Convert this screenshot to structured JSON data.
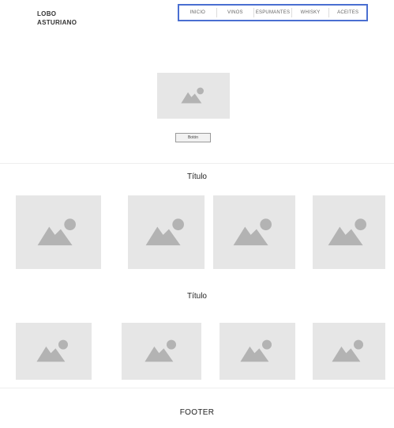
{
  "logo": {
    "line1": "LOBO",
    "line2": "ASTURIANO"
  },
  "nav": {
    "items": [
      {
        "label": "INICIO"
      },
      {
        "label": "VINOS"
      },
      {
        "label": "ESPUMANTES"
      },
      {
        "label": "WHISKY"
      },
      {
        "label": "ACEITES"
      }
    ],
    "border_color": "#4a6fd1"
  },
  "hero": {
    "image_icon": "image-placeholder-icon",
    "button_label": "Botón"
  },
  "sections": [
    {
      "title": "Título"
    },
    {
      "title": "Título"
    }
  ],
  "footer": {
    "label": "FOOTER"
  },
  "colors": {
    "placeholder_bg": "#e6e6e6",
    "placeholder_icon": "#b3b3b3"
  }
}
